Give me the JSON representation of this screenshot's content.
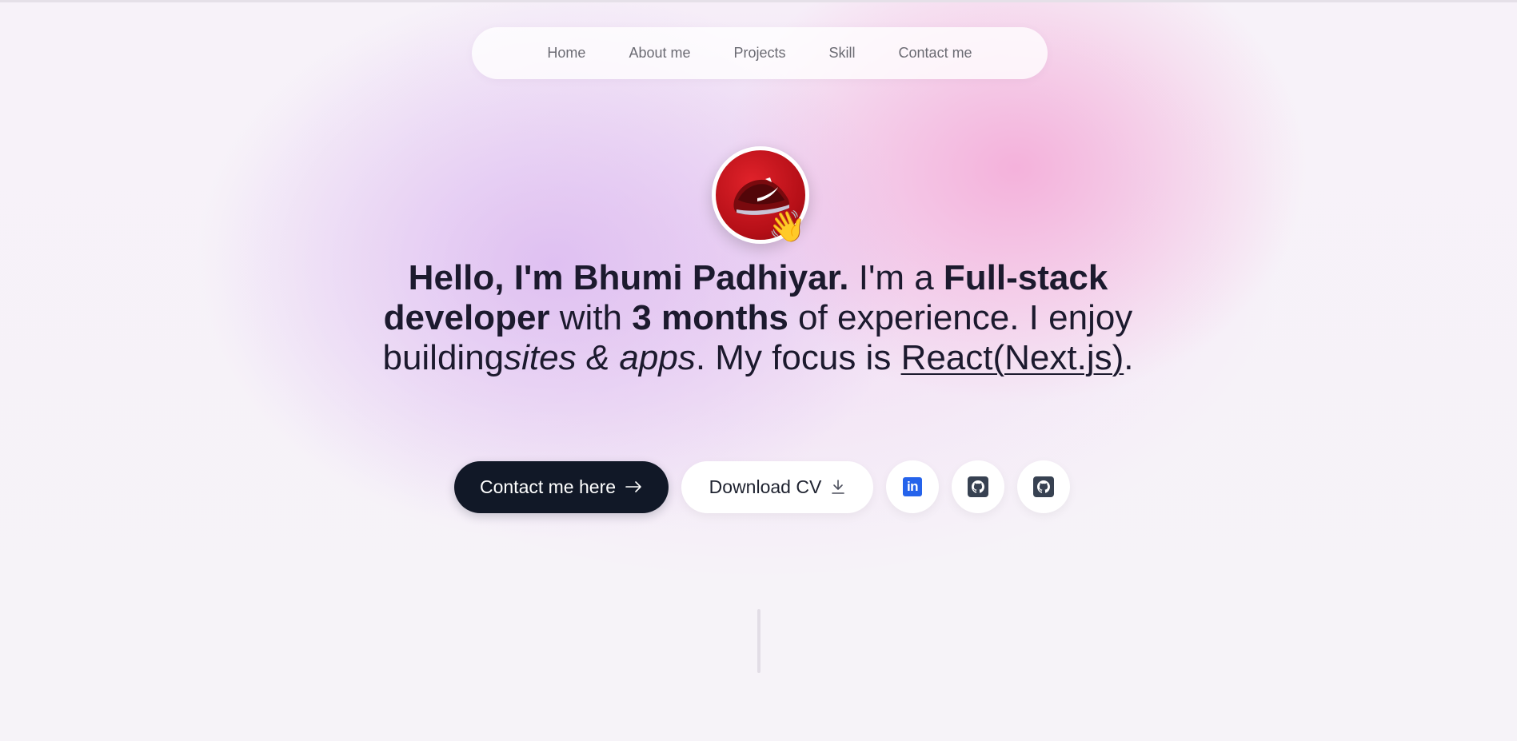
{
  "nav": {
    "items": [
      {
        "label": "Home"
      },
      {
        "label": "About me"
      },
      {
        "label": "Projects"
      },
      {
        "label": "Skill"
      },
      {
        "label": "Contact me"
      }
    ]
  },
  "profile": {
    "avatar_icon": "red-sneaker-photo",
    "wave_emoji": "👋"
  },
  "intro": {
    "greeting": "Hello, I'm Bhumi Padhiyar.",
    "im_a": " I'm a ",
    "role": "Full-stack developer",
    "with": " with ",
    "experience": "3 months",
    "of_experience": " of experience. I enjoy building",
    "what": "sites & apps",
    "focus": ". My focus is ",
    "framework": "React(Next.js)",
    "end": "."
  },
  "actions": {
    "contact_label": "Contact me here",
    "contact_icon": "arrow-right-icon",
    "download_label": "Download CV",
    "download_icon": "download-icon",
    "social": [
      {
        "icon": "linkedin-icon",
        "color": "#2563eb"
      },
      {
        "icon": "github-icon",
        "color": "#374151"
      },
      {
        "icon": "github-icon",
        "color": "#374151"
      }
    ]
  },
  "colors": {
    "primary_button": "#111827",
    "text": "#1c1a2e",
    "nav_text": "#6b6b73",
    "linkedin": "#2563eb"
  }
}
